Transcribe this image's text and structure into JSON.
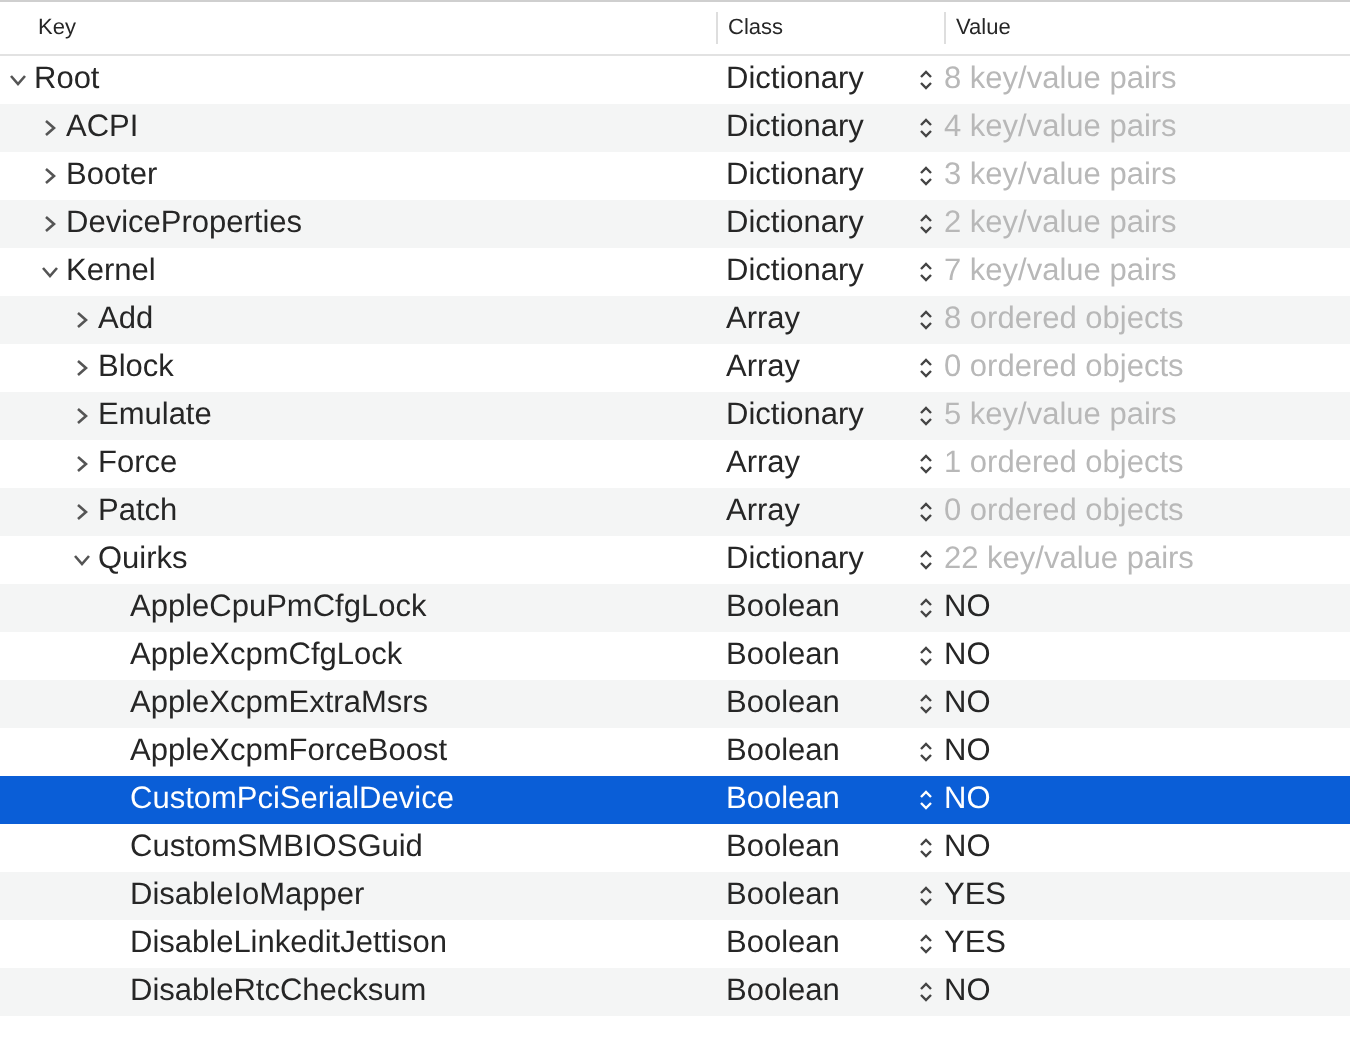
{
  "columns": [
    {
      "label": "Key"
    },
    {
      "label": "Class"
    },
    {
      "label": "Value"
    }
  ],
  "root": {
    "key": "Root",
    "class": "Dictionary",
    "value": "8 key/value pairs",
    "expanded": true,
    "selected": false,
    "children": [
      {
        "key": "ACPI",
        "class": "Dictionary",
        "value": "4 key/value pairs",
        "expanded": false,
        "selected": false
      },
      {
        "key": "Booter",
        "class": "Dictionary",
        "value": "3 key/value pairs",
        "expanded": false,
        "selected": false
      },
      {
        "key": "DeviceProperties",
        "class": "Dictionary",
        "value": "2 key/value pairs",
        "expanded": false,
        "selected": false
      },
      {
        "key": "Kernel",
        "class": "Dictionary",
        "value": "7 key/value pairs",
        "expanded": true,
        "selected": false,
        "children": [
          {
            "key": "Add",
            "class": "Array",
            "value": "8 ordered objects",
            "expanded": false,
            "selected": false
          },
          {
            "key": "Block",
            "class": "Array",
            "value": "0 ordered objects",
            "expanded": false,
            "selected": false
          },
          {
            "key": "Emulate",
            "class": "Dictionary",
            "value": "5 key/value pairs",
            "expanded": false,
            "selected": false
          },
          {
            "key": "Force",
            "class": "Array",
            "value": "1 ordered objects",
            "expanded": false,
            "selected": false
          },
          {
            "key": "Patch",
            "class": "Array",
            "value": "0 ordered objects",
            "expanded": false,
            "selected": false
          },
          {
            "key": "Quirks",
            "class": "Dictionary",
            "value": "22 key/value pairs",
            "expanded": true,
            "selected": false,
            "children": [
              {
                "key": "AppleCpuPmCfgLock",
                "class": "Boolean",
                "value": "NO",
                "selected": false
              },
              {
                "key": "AppleXcpmCfgLock",
                "class": "Boolean",
                "value": "NO",
                "selected": false
              },
              {
                "key": "AppleXcpmExtraMsrs",
                "class": "Boolean",
                "value": "NO",
                "selected": false
              },
              {
                "key": "AppleXcpmForceBoost",
                "class": "Boolean",
                "value": "NO",
                "selected": false
              },
              {
                "key": "CustomPciSerialDevice",
                "class": "Boolean",
                "value": "NO",
                "selected": true
              },
              {
                "key": "CustomSMBIOSGuid",
                "class": "Boolean",
                "value": "NO",
                "selected": false
              },
              {
                "key": "DisableIoMapper",
                "class": "Boolean",
                "value": "YES",
                "selected": false
              },
              {
                "key": "DisableLinkeditJettison",
                "class": "Boolean",
                "value": "YES",
                "selected": false
              },
              {
                "key": "DisableRtcChecksum",
                "class": "Boolean",
                "value": "NO",
                "selected": false
              }
            ]
          }
        ]
      }
    ]
  }
}
